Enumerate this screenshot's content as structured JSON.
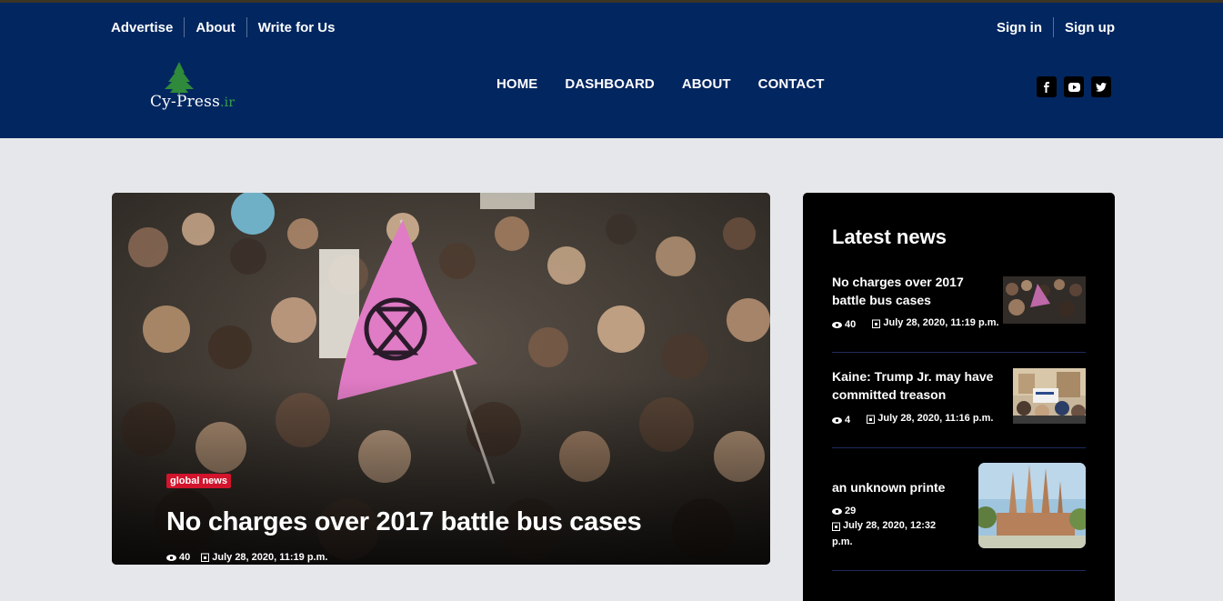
{
  "top_links": [
    "Advertise",
    "About",
    "Write for Us"
  ],
  "auth": {
    "sign_in": "Sign in",
    "sign_up": "Sign up"
  },
  "logo": {
    "text": "Cy-Press",
    "suffix": ".ir"
  },
  "nav": [
    "HOME",
    "DASHBOARD",
    "ABOUT",
    "CONTACT"
  ],
  "social": [
    "facebook-icon",
    "youtube-icon",
    "twitter-icon"
  ],
  "hero": {
    "category": "global news",
    "title": "No charges over 2017 battle bus cases",
    "views": "40",
    "date": "July 28, 2020, 11:19 p.m."
  },
  "sidebar": {
    "title": "Latest news",
    "items": [
      {
        "title_line1": "No charges over 2017",
        "title_line2": "battle bus cases",
        "views": "40",
        "date": "July 28, 2020, 11:19 p.m."
      },
      {
        "title_line1": "Kaine: Trump Jr. may have",
        "title_line2": "committed treason",
        "views": "4",
        "date": "July 28, 2020, 11:16 p.m."
      },
      {
        "title_line1": "an unknown printe",
        "title_line2": "",
        "views": "29",
        "date_line1": "July 28, 2020, 12:32",
        "date_line2": "p.m."
      }
    ]
  },
  "colors": {
    "header_bg": "#022660",
    "page_bg": "#e6e7ea",
    "badge": "#d2142c",
    "sidebar_bg": "#000000"
  }
}
